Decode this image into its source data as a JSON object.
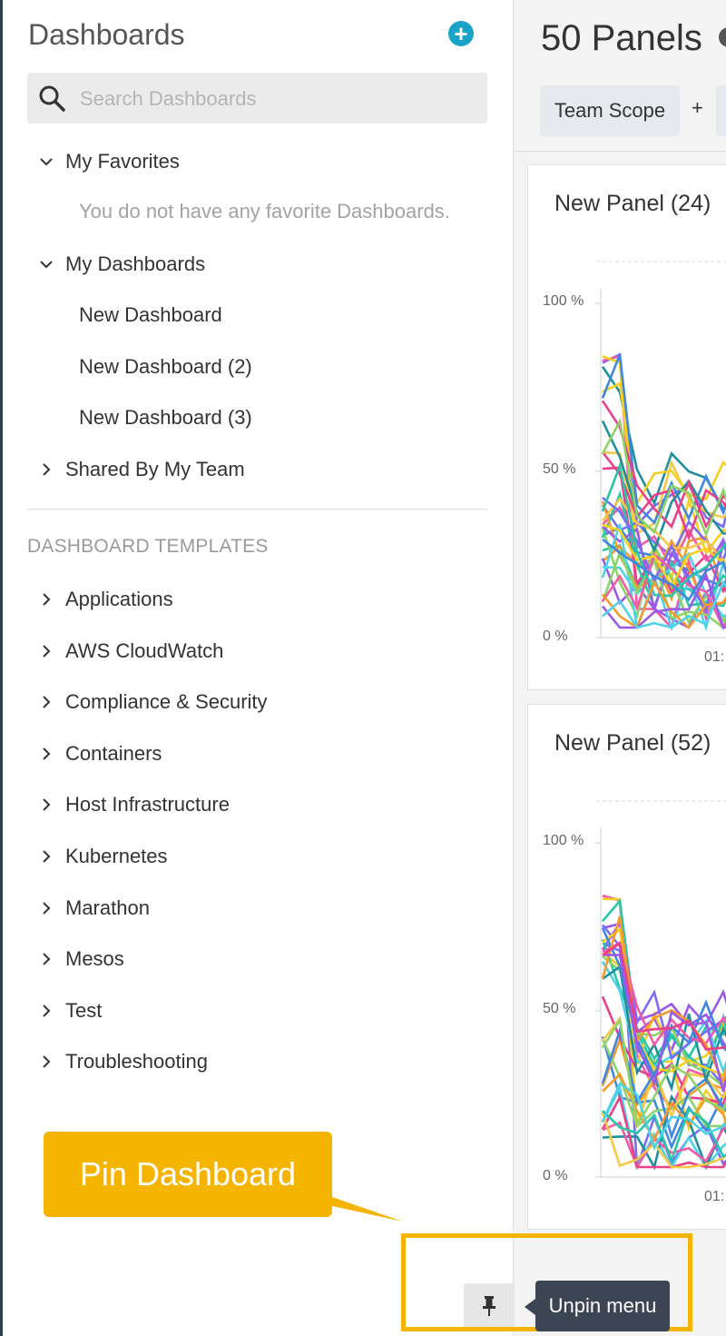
{
  "sidebar": {
    "title": "Dashboards",
    "search_placeholder": "Search Dashboards",
    "favorites": {
      "label": "My Favorites",
      "empty": "You do not have any favorite Dashboards."
    },
    "my_dashboards": {
      "label": "My Dashboards",
      "items": [
        "New Dashboard",
        "New Dashboard (2)",
        "New Dashboard (3)"
      ]
    },
    "shared": {
      "label": "Shared By My Team"
    },
    "templates_heading": "DASHBOARD TEMPLATES",
    "templates": [
      "Applications",
      "AWS CloudWatch",
      "Compliance & Security",
      "Containers",
      "Host Infrastructure",
      "Kubernetes",
      "Marathon",
      "Mesos",
      "Test",
      "Troubleshooting"
    ]
  },
  "main": {
    "title": "50 Panels",
    "scope_label": "Team Scope",
    "scope_add": "+",
    "panels": [
      {
        "title": "New Panel (24)",
        "y_ticks": [
          "100 %",
          "50 %",
          "0 %"
        ],
        "x_tick": "01:"
      },
      {
        "title": "New Panel (52)",
        "y_ticks": [
          "100 %",
          "50 %",
          "0 %"
        ],
        "x_tick": "01:"
      }
    ]
  },
  "callout": {
    "text": "Pin Dashboard"
  },
  "tooltip": {
    "text": "Unpin menu"
  },
  "colors": {
    "accent": "#1aa3c8",
    "callout": "#f5b400",
    "tooltip": "#3b4554"
  }
}
